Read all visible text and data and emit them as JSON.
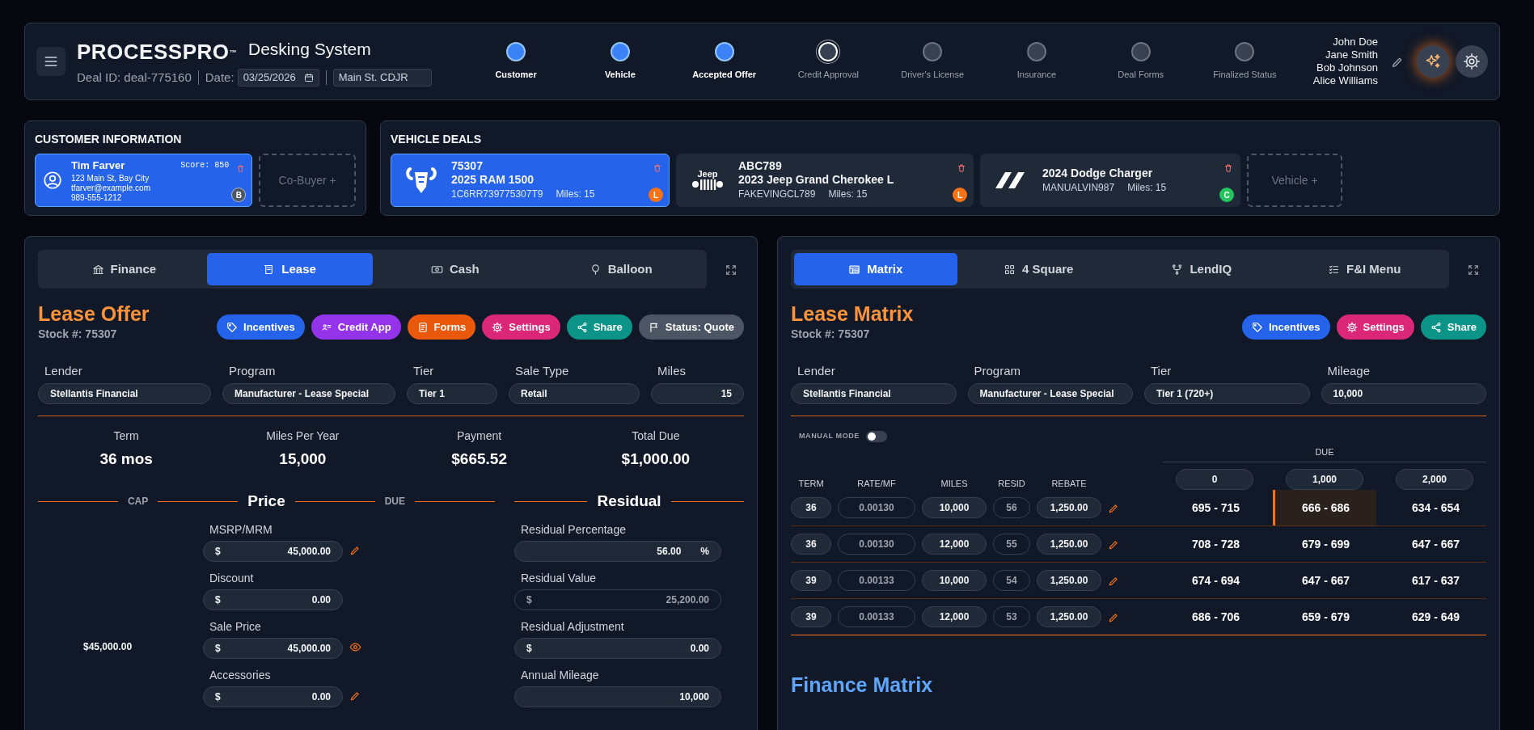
{
  "header": {
    "logo": "PROCESSPRO$^{™}$",
    "app_title": "Desking System",
    "deal_id": "Deal ID: deal-775160",
    "date_label": "Date:",
    "date": "03/25/2026",
    "location": "Main St. CDJR",
    "steps": [
      {
        "label": "Customer",
        "kind": "done"
      },
      {
        "label": "Vehicle",
        "kind": "done"
      },
      {
        "label": "Accepted Offer",
        "kind": "done"
      },
      {
        "label": "Credit Approval",
        "kind": "current"
      },
      {
        "label": "Driver's License",
        "kind": "pending"
      },
      {
        "label": "Insurance",
        "kind": "pending"
      },
      {
        "label": "Deal Forms",
        "kind": "pending"
      },
      {
        "label": "Finalized Status",
        "kind": "pending"
      }
    ],
    "users": [
      "John Doe",
      "Jane Smith",
      "Bob Johnson",
      "Alice Williams"
    ]
  },
  "customer": {
    "title": "CUSTOMER INFORMATION",
    "buyer": {
      "name": "Tim Farver",
      "score": "Score: 850",
      "address": "123 Main St, Bay City",
      "email": "tfarver@example.com",
      "phone": "989-555-1212",
      "badge": "B"
    },
    "cobuyer": "Co-Buyer +"
  },
  "vehicles": {
    "title": "VEHICLE DEALS",
    "items": [
      {
        "kind": "ram",
        "stock": "75307",
        "name": "2025 RAM 1500",
        "vin": "1C6RR739775307T9",
        "miles": "Miles: 15",
        "badge": "L",
        "color": "#f97316",
        "selected": true
      },
      {
        "kind": "jeep",
        "logo_text": "Jeep",
        "stock": "ABC789",
        "name": "2023 Jeep Grand Cherokee L",
        "vin": "FAKEVINGCL789",
        "miles": "Miles: 15",
        "badge": "L",
        "color": "#f97316",
        "selected": false
      },
      {
        "kind": "dodge",
        "name": "2024 Dodge Charger",
        "vin": "MANUALVIN987",
        "miles": "Miles: 15",
        "badge": "C",
        "color": "#22c55e",
        "selected": false
      }
    ],
    "add": "Vehicle +"
  },
  "lease_offer": {
    "tabs": [
      {
        "kind": "bank",
        "label": "Finance",
        "selected": false
      },
      {
        "kind": "scroll",
        "label": "Lease",
        "selected": true
      },
      {
        "kind": "cash",
        "label": "Cash",
        "selected": false
      },
      {
        "kind": "balloon",
        "label": "Balloon",
        "selected": false
      }
    ],
    "title": "Lease Offer",
    "stock": "Stock #: 75307",
    "actions": [
      {
        "kind": "incentives",
        "label": "Incentives",
        "color": "#2563eb"
      },
      {
        "kind": "credit",
        "label": "Credit App",
        "color": "#9333ea"
      },
      {
        "kind": "forms",
        "label": "Forms",
        "color": "#ea580c"
      },
      {
        "kind": "settings",
        "label": "Settings",
        "color": "#db2777"
      },
      {
        "kind": "share",
        "label": "Share",
        "color": "#0d9488"
      },
      {
        "kind": "status",
        "label": "Status: Quote",
        "color": "#4b5563"
      }
    ],
    "fields": [
      {
        "kind": "select",
        "label": "Lender",
        "value": "Stellantis Financial"
      },
      {
        "kind": "select",
        "label": "Program",
        "value": "Manufacturer - Lease Special"
      },
      {
        "kind": "select",
        "label": "Tier",
        "value": "Tier 1"
      },
      {
        "kind": "select",
        "label": "Sale Type",
        "value": "Retail"
      },
      {
        "kind": "number",
        "label": "Miles",
        "value": "15"
      }
    ],
    "summary": [
      {
        "label": "Term",
        "value": "36 mos"
      },
      {
        "label": "Miles Per Year",
        "value": "15,000"
      },
      {
        "label": "Payment",
        "value": "$665.52"
      },
      {
        "label": "Total Due",
        "value": "$1,000.00"
      }
    ],
    "price": {
      "cap_label": "CAP",
      "title": "Price",
      "due_label": "DUE",
      "fields": [
        {
          "label": "MSRP/MRM",
          "prefix": "$",
          "value": "45,000.00",
          "kind": "edit"
        },
        {
          "label": "Discount",
          "prefix": "$",
          "value": "0.00",
          "kind": "plain"
        },
        {
          "label": "Sale Price",
          "prefix": "$",
          "value": "45,000.00",
          "kind": "view",
          "cap": "$45,000.00"
        },
        {
          "label": "Accessories",
          "prefix": "$",
          "value": "0.00",
          "kind": "edit"
        }
      ]
    },
    "residual": {
      "title": "Residual",
      "fields": [
        {
          "label": "Residual Percentage",
          "value": "56.00",
          "suffix": "%",
          "disabled": false
        },
        {
          "label": "Residual Value",
          "prefix": "$",
          "value": "25,200.00",
          "disabled": true
        },
        {
          "label": "Residual Adjustment",
          "prefix": "$",
          "value": "0.00",
          "disabled": false
        },
        {
          "label": "Annual Mileage",
          "value": "10,000",
          "disabled": false
        }
      ]
    }
  },
  "lease_matrix": {
    "tabs": [
      {
        "kind": "table",
        "label": "Matrix",
        "selected": true
      },
      {
        "kind": "grid",
        "label": "4 Square",
        "selected": false
      },
      {
        "kind": "fork",
        "label": "LendIQ",
        "selected": false
      },
      {
        "kind": "list",
        "label": "F&I Menu",
        "selected": false
      }
    ],
    "title": "Lease Matrix",
    "stock": "Stock #: 75307",
    "actions": [
      {
        "kind": "incentives",
        "label": "Incentives",
        "color": "#2563eb"
      },
      {
        "kind": "settings",
        "label": "Settings",
        "color": "#db2777"
      },
      {
        "kind": "share",
        "label": "Share",
        "color": "#0d9488"
      }
    ],
    "fields": [
      {
        "label": "Lender",
        "value": "Stellantis Financial"
      },
      {
        "label": "Program",
        "value": "Manufacturer - Lease Special"
      },
      {
        "label": "Tier",
        "value": "Tier 1 (720+)"
      },
      {
        "label": "Mileage",
        "value": "10,000"
      }
    ],
    "manual_mode": {
      "label": "MANUAL MODE",
      "on": false
    },
    "columns": [
      "TERM",
      "RATE/MF",
      "MILES",
      "RESID",
      "REBATE"
    ],
    "due_label": "DUE",
    "due": [
      "0",
      "1,000",
      "2,000"
    ],
    "rows": [
      {
        "term": "36",
        "rate": "0.00130",
        "miles": "10,000",
        "resid": "56",
        "rebate": "1,250.00",
        "payments": [
          {
            "text": "695 - 715",
            "selected": false
          },
          {
            "text": "666 - 686",
            "selected": true
          },
          {
            "text": "634 - 654",
            "selected": false
          }
        ]
      },
      {
        "term": "36",
        "rate": "0.00130",
        "miles": "12,000",
        "resid": "55",
        "rebate": "1,250.00",
        "payments": [
          {
            "text": "708 - 728",
            "selected": false
          },
          {
            "text": "679 - 699",
            "selected": false
          },
          {
            "text": "647 - 667",
            "selected": false
          }
        ]
      },
      {
        "term": "39",
        "rate": "0.00133",
        "miles": "10,000",
        "resid": "54",
        "rebate": "1,250.00",
        "payments": [
          {
            "text": "674 - 694",
            "selected": false
          },
          {
            "text": "647 - 667",
            "selected": false
          },
          {
            "text": "617 - 637",
            "selected": false
          }
        ]
      },
      {
        "term": "39",
        "rate": "0.00133",
        "miles": "12,000",
        "resid": "53",
        "rebate": "1,250.00",
        "payments": [
          {
            "text": "686 - 706",
            "selected": false
          },
          {
            "text": "659 - 679",
            "selected": false
          },
          {
            "text": "629 - 649",
            "selected": false
          }
        ]
      }
    ]
  },
  "finance_matrix": {
    "title": "Finance Matrix"
  }
}
